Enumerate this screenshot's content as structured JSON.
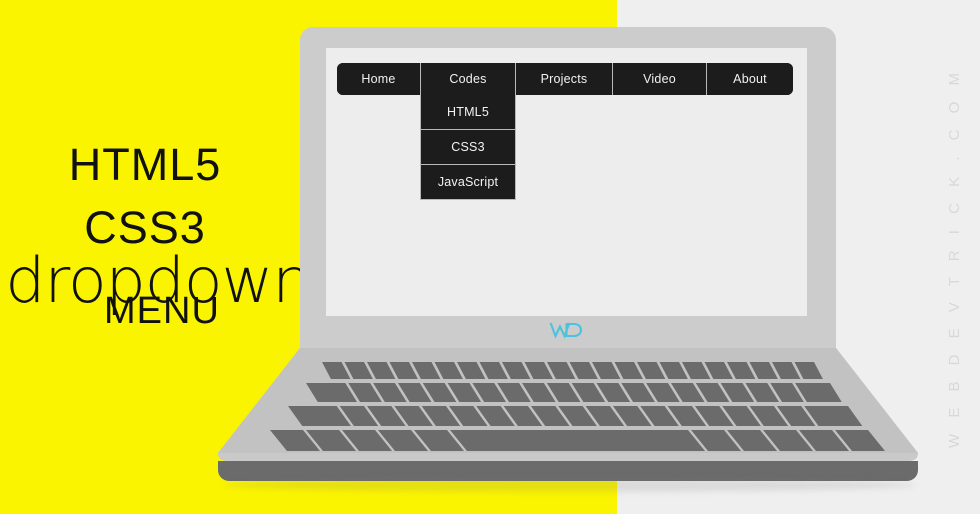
{
  "promo": {
    "line1": "HTML5",
    "line2": "CSS3",
    "line3": "dropdown",
    "line4": "MENU"
  },
  "watermark": {
    "text": "W E B D E V T R I C K . C O M"
  },
  "device": {
    "brand_logo": "WD",
    "logo_color": "#4cc3dd",
    "body_color": "#cccccc",
    "screen_color": "#ededed",
    "key_color": "#6b6b6b"
  },
  "background": {
    "accent_color": "#fbf400",
    "neutral_color": "#efefef"
  },
  "site": {
    "navbar": {
      "background": "#1c1c1c",
      "text_color": "#f2f2f2",
      "items": [
        {
          "label": "Home",
          "width_class": "w-home",
          "has_dropdown": false
        },
        {
          "label": "Codes",
          "width_class": "w-codes",
          "has_dropdown": true
        },
        {
          "label": "Projects",
          "width_class": "w-projects",
          "has_dropdown": false
        },
        {
          "label": "Video",
          "width_class": "w-video",
          "has_dropdown": false
        },
        {
          "label": "About",
          "width_class": "w-about",
          "has_dropdown": false
        }
      ]
    },
    "dropdown": {
      "parent": "Codes",
      "open": true,
      "items": [
        {
          "label": "HTML5"
        },
        {
          "label": "CSS3"
        },
        {
          "label": "JavaScript"
        }
      ]
    }
  }
}
